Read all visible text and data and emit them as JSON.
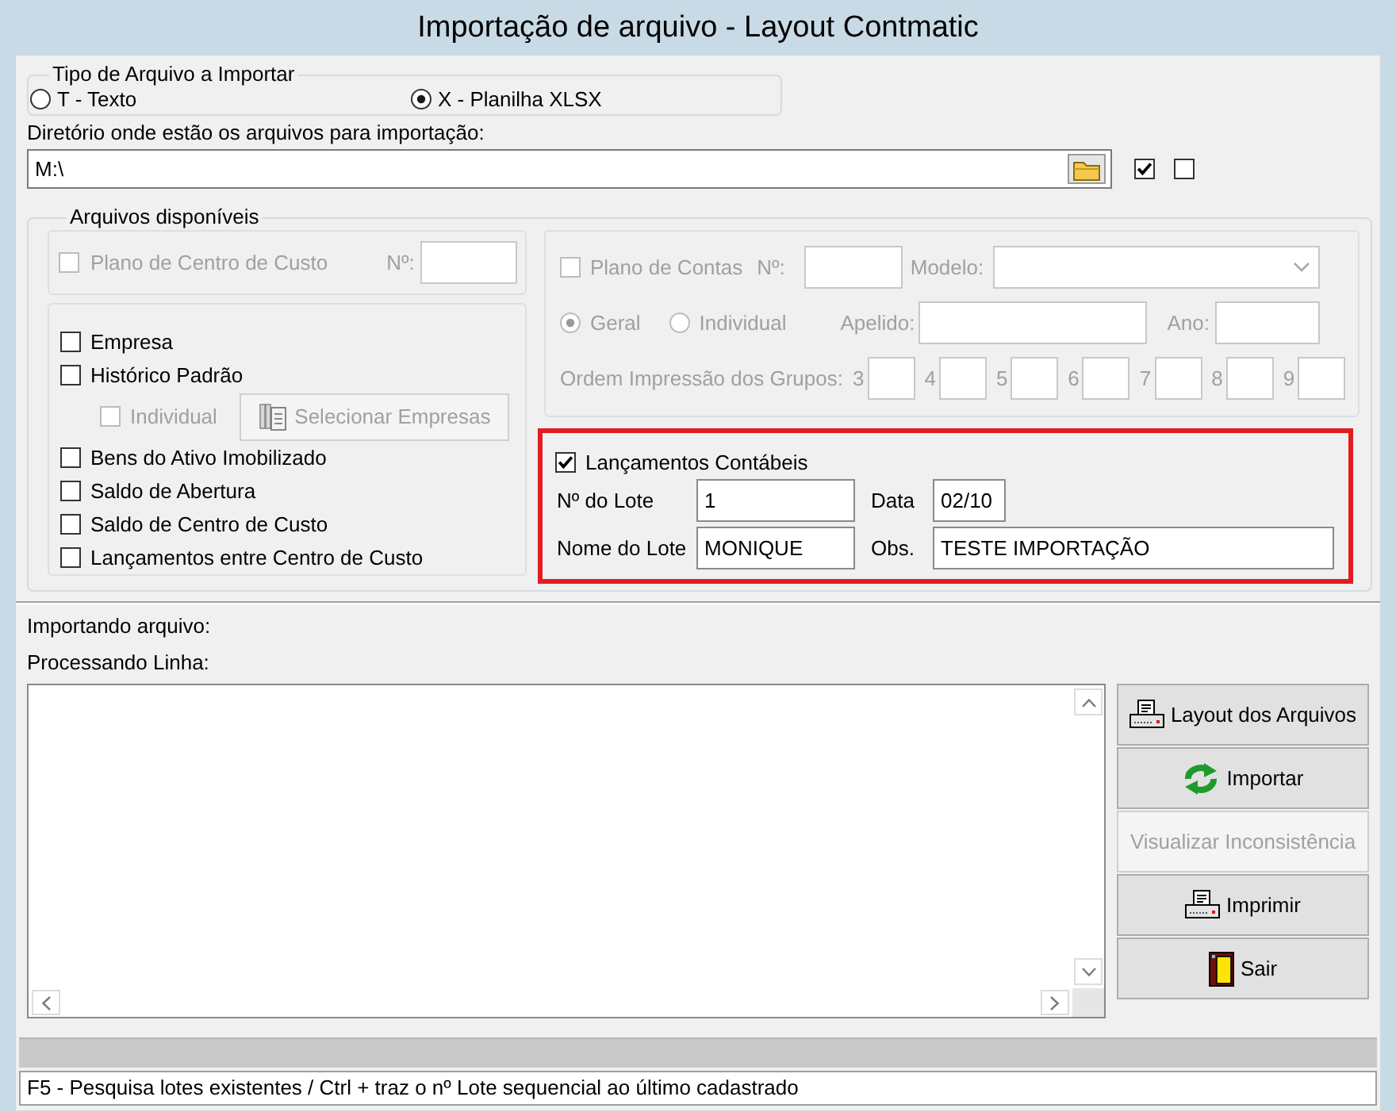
{
  "window": {
    "title": "Importação de arquivo - Layout Contmatic"
  },
  "file_type": {
    "title": "Tipo de Arquivo a Importar",
    "options": [
      {
        "label": "T - Texto",
        "selected": false
      },
      {
        "label": "X - Planilha XLSX",
        "selected": true
      }
    ]
  },
  "directory": {
    "label": "Diretório onde estão os arquivos para importação:",
    "value": "M:\\",
    "toggles": [
      {
        "checked": true
      },
      {
        "checked": false
      }
    ]
  },
  "available_files": {
    "title": "Arquivos disponíveis",
    "cost_center_plan": {
      "label": "Plano de Centro de Custo",
      "checked": false,
      "disabled": true,
      "number_label": "Nº:"
    },
    "items": [
      {
        "kind": "check",
        "label": "Empresa",
        "checked": false,
        "disabled": false
      },
      {
        "kind": "check",
        "label": "Histórico Padrão",
        "checked": false,
        "disabled": false
      },
      {
        "kind": "sub",
        "label": "Individual",
        "checked": false,
        "disabled": true,
        "button": "Selecionar Empresas"
      },
      {
        "kind": "check",
        "label": "Bens do Ativo Imobilizado",
        "checked": false,
        "disabled": false
      },
      {
        "kind": "check",
        "label": "Saldo de Abertura",
        "checked": false,
        "disabled": false
      },
      {
        "kind": "check",
        "label": "Saldo de Centro de Custo",
        "checked": false,
        "disabled": false
      },
      {
        "kind": "check",
        "label": "Lançamentos entre Centro de Custo",
        "checked": false,
        "disabled": false
      }
    ],
    "chart_of_accounts": {
      "label": "Plano de Contas",
      "checked": false,
      "disabled": true,
      "number_label": "Nº:",
      "model_label": "Modelo:",
      "scope": [
        {
          "label": "Geral",
          "selected": true
        },
        {
          "label": "Individual",
          "selected": false
        }
      ],
      "nickname_label": "Apelido:",
      "year_label": "Ano:",
      "group_order_label": "Ordem Impressão dos Grupos:",
      "group_order": [
        "3",
        "4",
        "5",
        "6",
        "7",
        "8",
        "9"
      ]
    },
    "entries": {
      "label": "Lançamentos Contábeis",
      "checked": true,
      "highlighted": true,
      "fields": [
        [
          {
            "label": "Nº do Lote",
            "value": "1"
          },
          {
            "label": "Data",
            "value": "02/10"
          }
        ],
        [
          {
            "label": "Nome do Lote",
            "value": "MONIQUE"
          },
          {
            "label": "Obs.",
            "value": "TESTE IMPORTAÇÃO"
          }
        ]
      ]
    }
  },
  "progress": {
    "file_label": "Importando arquivo:",
    "line_label": "Processando Linha:"
  },
  "actions": [
    {
      "kind": "layout",
      "label": "Layout dos Arquivos",
      "disabled": false
    },
    {
      "kind": "import",
      "label": "Importar",
      "disabled": false
    },
    {
      "kind": "inspect",
      "label": "Visualizar Inconsistência",
      "disabled": true
    },
    {
      "kind": "print",
      "label": "Imprimir",
      "disabled": false
    },
    {
      "kind": "exit",
      "label": "Sair",
      "disabled": false
    }
  ],
  "status_bar": {
    "hint": "F5 - Pesquisa lotes existentes / Ctrl + traz o nº Lote sequencial ao último cadastrado"
  }
}
